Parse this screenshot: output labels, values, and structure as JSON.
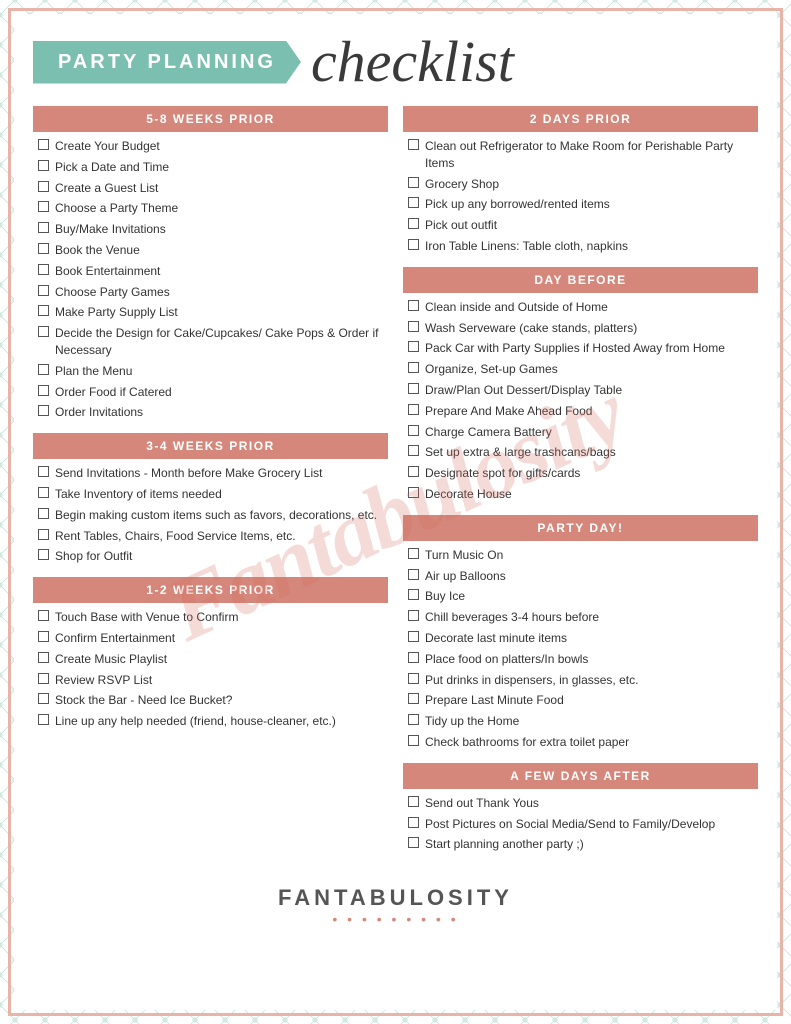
{
  "header": {
    "banner_text": "PARTY PLANNING",
    "script_text": "checklist"
  },
  "watermark": "Fantabulosity",
  "footer": {
    "brand": "FANTABULOSITY",
    "dots": "• • • • • • • • •"
  },
  "sections": {
    "col_left": [
      {
        "id": "weeks_5_8",
        "header": "5-8 WEEKS PRIOR",
        "items": [
          "Create Your Budget",
          "Pick a Date and Time",
          "Create a Guest List",
          "Choose a Party Theme",
          "Buy/Make Invitations",
          "Book the Venue",
          "Book Entertainment",
          "Choose Party Games",
          "Make Party Supply List",
          "Decide the Design for Cake/Cupcakes/ Cake Pops & Order if Necessary",
          "Plan the Menu",
          "Order Food if Catered",
          "Order Invitations"
        ]
      },
      {
        "id": "weeks_3_4",
        "header": "3-4 WEEKS PRIOR",
        "items": [
          "Send Invitations - Month before Make Grocery List",
          "Take Inventory of items needed",
          "Begin making custom items such as favors, decorations, etc.",
          "Rent Tables, Chairs, Food Service Items, etc.",
          "Shop for Outfit"
        ]
      },
      {
        "id": "weeks_1_2",
        "header": "1-2 WEEKS PRIOR",
        "items": [
          "Touch Base with Venue to Confirm",
          "Confirm Entertainment",
          "Create Music Playlist",
          "Review RSVP List",
          "Stock the Bar - Need Ice Bucket?",
          "Line up any help needed (friend, house-cleaner, etc.)"
        ]
      }
    ],
    "col_right": [
      {
        "id": "days_2",
        "header": "2 DAYS PRIOR",
        "items": [
          "Clean out Refrigerator to Make Room for Perishable Party Items",
          "Grocery Shop",
          "Pick up any borrowed/rented items",
          "Pick out outfit",
          "Iron Table Linens: Table cloth, napkins"
        ]
      },
      {
        "id": "day_before",
        "header": "DAY BEFORE",
        "items": [
          "Clean inside and Outside of Home",
          "Wash Serveware (cake stands, platters)",
          "Pack Car with Party Supplies if Hosted Away from Home",
          "Organize, Set-up Games",
          "Draw/Plan Out Dessert/Display Table",
          "Prepare And Make Ahead Food",
          "Charge Camera Battery",
          "Set up extra & large trashcans/bags",
          "Designate spot for gifts/cards",
          "Decorate House"
        ]
      },
      {
        "id": "party_day",
        "header": "PARTY DAY!",
        "items": [
          "Turn Music On",
          "Air up Balloons",
          "Buy Ice",
          "Chill beverages 3-4 hours before",
          " Decorate last minute items",
          "Place food on platters/In bowls",
          "Put drinks in dispensers, in glasses, etc.",
          "Prepare Last Minute Food",
          "Tidy up the Home",
          "Check bathrooms for extra toilet paper"
        ]
      },
      {
        "id": "days_after",
        "header": "A FEW DAYS AFTER",
        "items": [
          "Send out Thank Yous",
          "Post Pictures on Social Media/Send to Family/Develop",
          "Start planning another party ;)"
        ]
      }
    ]
  }
}
